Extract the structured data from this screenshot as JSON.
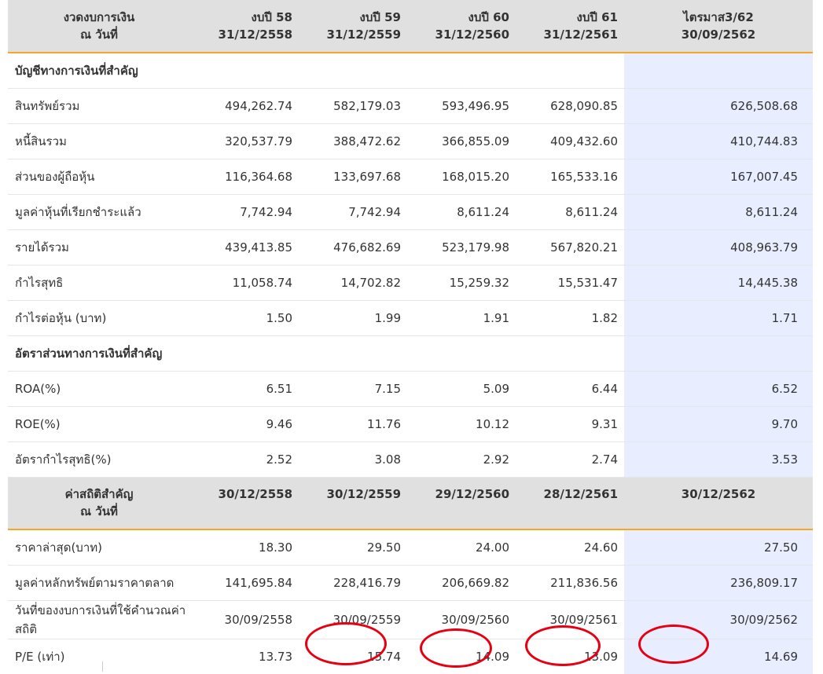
{
  "header1": {
    "label_line1": "งวดงบการเงิน",
    "label_line2": "ณ วันที่",
    "columns": [
      {
        "line1": "งบปี 58",
        "line2": "31/12/2558"
      },
      {
        "line1": "งบปี 59",
        "line2": "31/12/2559"
      },
      {
        "line1": "งบปี 60",
        "line2": "31/12/2560"
      },
      {
        "line1": "งบปี 61",
        "line2": "31/12/2561"
      },
      {
        "line1": "ไตรมาส3/62",
        "line2": "30/09/2562"
      }
    ]
  },
  "section1": {
    "title": "บัญชีทางการเงินที่สำคัญ",
    "rows": [
      {
        "label": "สินทรัพย์รวม",
        "values": [
          "494,262.74",
          "582,179.03",
          "593,496.95",
          "628,090.85",
          "626,508.68"
        ]
      },
      {
        "label": "หนี้สินรวม",
        "values": [
          "320,537.79",
          "388,472.62",
          "366,855.09",
          "409,432.60",
          "410,744.83"
        ]
      },
      {
        "label": "ส่วนของผู้ถือหุ้น",
        "values": [
          "116,364.68",
          "133,697.68",
          "168,015.20",
          "165,533.16",
          "167,007.45"
        ]
      },
      {
        "label": "มูลค่าหุ้นที่เรียกชำระแล้ว",
        "values": [
          "7,742.94",
          "7,742.94",
          "8,611.24",
          "8,611.24",
          "8,611.24"
        ]
      },
      {
        "label": "รายได้รวม",
        "values": [
          "439,413.85",
          "476,682.69",
          "523,179.98",
          "567,820.21",
          "408,963.79"
        ]
      },
      {
        "label": "กำไรสุทธิ",
        "values": [
          "11,058.74",
          "14,702.82",
          "15,259.32",
          "15,531.47",
          "14,445.38"
        ]
      },
      {
        "label": "กำไรต่อหุ้น (บาท)",
        "values": [
          "1.50",
          "1.99",
          "1.91",
          "1.82",
          "1.71"
        ]
      }
    ]
  },
  "section2": {
    "title": "อัตราส่วนทางการเงินที่สำคัญ",
    "rows": [
      {
        "label": "ROA(%)",
        "values": [
          "6.51",
          "7.15",
          "5.09",
          "6.44",
          "6.52"
        ]
      },
      {
        "label": "ROE(%)",
        "values": [
          "9.46",
          "11.76",
          "10.12",
          "9.31",
          "9.70"
        ]
      },
      {
        "label": "อัตรากำไรสุทธิ(%)",
        "values": [
          "2.52",
          "3.08",
          "2.92",
          "2.74",
          "3.53"
        ]
      }
    ]
  },
  "header2": {
    "label_line1": "ค่าสถิติสำคัญ",
    "label_line2": "ณ วันที่",
    "columns": [
      "30/12/2558",
      "30/12/2559",
      "29/12/2560",
      "28/12/2561",
      "30/12/2562"
    ]
  },
  "section3": {
    "rows": [
      {
        "label": "ราคาล่าสุด(บาท)",
        "values": [
          "18.30",
          "29.50",
          "24.00",
          "24.60",
          "27.50"
        ]
      },
      {
        "label": "มูลค่าหลักทรัพย์ตามราคาตลาด",
        "values": [
          "141,695.84",
          "228,416.79",
          "206,669.82",
          "211,836.56",
          "236,809.17"
        ]
      },
      {
        "label": "วันที่ของงบการเงินที่ใช้คำนวณค่าสถิติ",
        "values": [
          "30/09/2558",
          "30/09/2559",
          "30/09/2560",
          "30/09/2561",
          "30/09/2562"
        ]
      },
      {
        "label": "P/E (เท่า)",
        "values": [
          "13.73",
          "15.74",
          "14.09",
          "13.09",
          "14.69"
        ]
      }
    ]
  },
  "colors": {
    "highlight_column": "#e8eeff",
    "header_bg": "#e0e0e0",
    "header_border": "#f5a623",
    "annotation_circle": "#e60012"
  }
}
